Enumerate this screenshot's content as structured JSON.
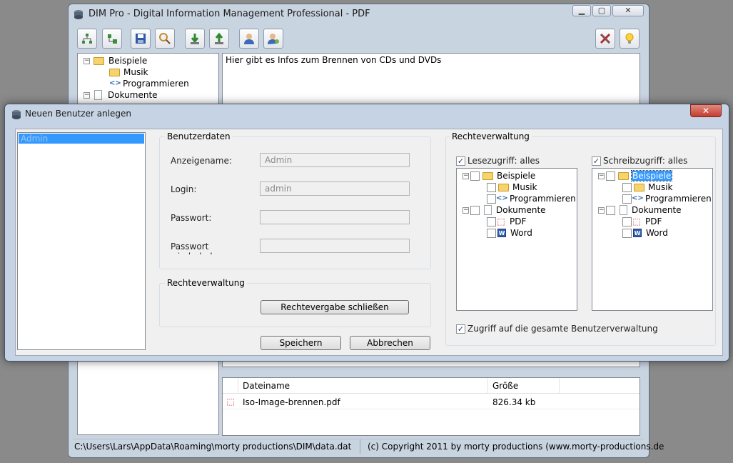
{
  "main_window": {
    "title": "DIM Pro - Digital Information Management Professional - PDF",
    "caption_buttons": {
      "minimize": "▁",
      "maximize": "▢",
      "close": "✕"
    },
    "tree": [
      {
        "label": "Beispiele",
        "icon": "folder-icon",
        "level": 0,
        "expander": "−"
      },
      {
        "label": "Musik",
        "icon": "folder-icon",
        "level": 1
      },
      {
        "label": "Programmieren",
        "icon": "code-file-icon",
        "level": 1
      },
      {
        "label": "Dokumente",
        "icon": "document-icon",
        "level": 0,
        "expander": "−"
      }
    ],
    "description_text": "Hier gibt es Infos zum Brennen von CDs und DVDs",
    "file_table": {
      "headers": [
        "Dateiname",
        "Größe"
      ],
      "rows": [
        {
          "name": "Iso-Image-brennen.pdf",
          "size": "826.34 kb"
        }
      ]
    },
    "status_path": "C:\\Users\\Lars\\AppData\\Roaming\\morty productions\\DIM\\data.dat",
    "status_copyright": "(c) Copyright 2011 by morty productions (www.morty-productions.de"
  },
  "dialog": {
    "title": "Neuen Benutzer anlegen",
    "close_glyph": "✕",
    "user_list": [
      "Admin"
    ],
    "benutzerdaten": {
      "title": "Benutzerdaten",
      "display_name_label": "Anzeigename:",
      "display_name_value": "Admin",
      "login_label": "Login:",
      "login_value": "admin",
      "password_label": "Passwort:",
      "password_value": "",
      "password_repeat_label": "Passwort wiederholen:",
      "password_repeat_value": ""
    },
    "rechte_left": {
      "title": "Rechteverwaltung",
      "close_rights_button": "Rechtevergabe schließen"
    },
    "save_button": "Speichern",
    "cancel_button": "Abbrechen",
    "rechte_right": {
      "title": "Rechteverwaltung",
      "read_all_label": "Lesezugriff: alles",
      "read_all_checked": true,
      "write_all_label": "Schreibzugriff: alles",
      "write_all_checked": true,
      "tree_items": [
        {
          "label": "Beispiele",
          "icon": "folder-icon",
          "level": 0,
          "expander": "−"
        },
        {
          "label": "Musik",
          "icon": "folder-icon",
          "level": 1
        },
        {
          "label": "Programmieren",
          "icon": "code-file-icon",
          "level": 1
        },
        {
          "label": "Dokumente",
          "icon": "document-icon",
          "level": 0,
          "expander": "−"
        },
        {
          "label": "PDF",
          "icon": "pdf-icon",
          "level": 1
        },
        {
          "label": "Word",
          "icon": "word-icon",
          "level": 1
        }
      ],
      "write_selected_item": "Beispiele",
      "user_admin_label": "Zugriff auf die gesamte Benutzerverwaltung",
      "user_admin_checked": true
    }
  },
  "colors": {
    "selection": "#3399ff",
    "frame": "#c9d4e1",
    "close_red": "#c9463d"
  }
}
